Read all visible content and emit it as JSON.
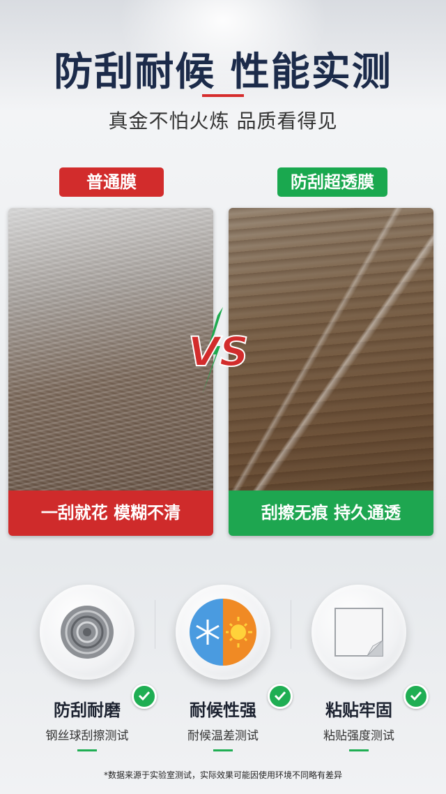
{
  "header": {
    "title": "防刮耐候 性能实测",
    "subtitle": "真金不怕火炼 品质看得见"
  },
  "comparison": {
    "left": {
      "label": "普通膜",
      "caption": "一刮就花 模糊不清"
    },
    "right": {
      "label": "防刮超透膜",
      "caption": "刮擦无痕 持久通透"
    },
    "vs_text": "VS"
  },
  "features": [
    {
      "title": "防刮耐磨",
      "subtitle": "钢丝球刮擦测试",
      "icon": "steel-wool-icon"
    },
    {
      "title": "耐候性强",
      "subtitle": "耐候温差测试",
      "icon": "snow-sun-icon"
    },
    {
      "title": "粘贴牢固",
      "subtitle": "粘贴强度测试",
      "icon": "film-peel-icon"
    }
  ],
  "footnote": "*数据来源于实验室测试，实际效果可能因使用环境不同略有差异",
  "colors": {
    "red": "#d22c2c",
    "green": "#1aa84f",
    "navy": "#1c2b4a"
  }
}
